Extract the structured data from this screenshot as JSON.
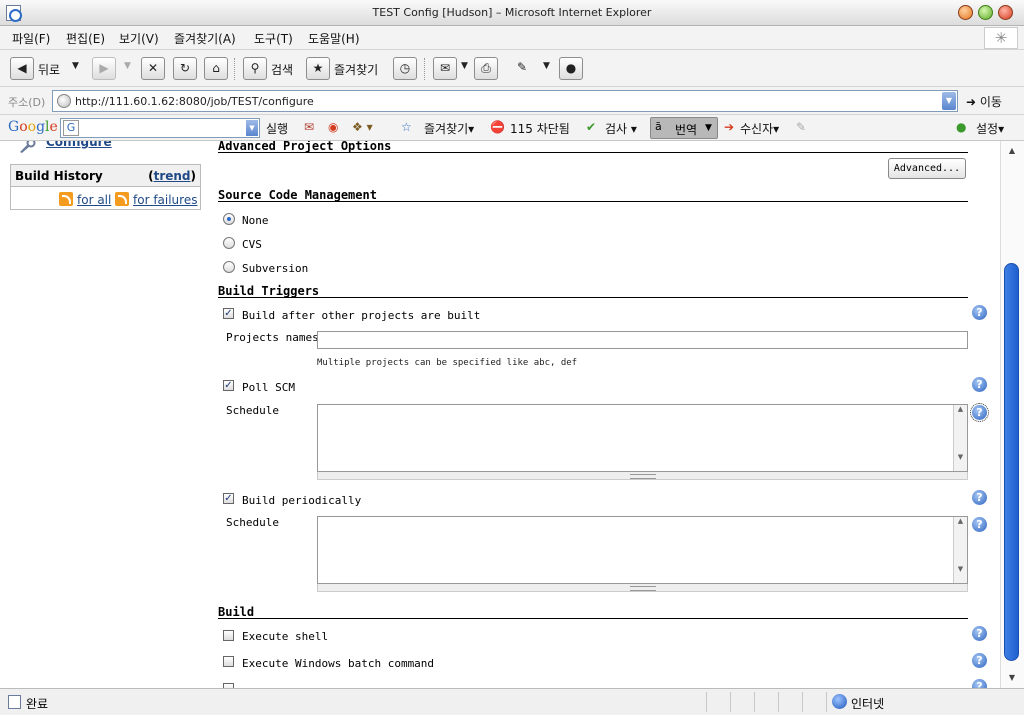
{
  "window": {
    "title": "TEST Config [Hudson] – Microsoft Internet Explorer"
  },
  "menu": [
    "파일(F)",
    "편집(E)",
    "보기(V)",
    "즐겨찾기(A)",
    "도구(T)",
    "도움말(H)"
  ],
  "toolbar": {
    "back": "뒤로",
    "search": "검색",
    "favorites": "즐겨찾기"
  },
  "address": {
    "label": "주소(D)",
    "url": "http://111.60.1.62:8080/job/TEST/configure",
    "go": "이동"
  },
  "google": {
    "logo": "Google",
    "run": "실행",
    "favorites": "즐겨찾기",
    "blocked": "115 차단됨",
    "check": "검사",
    "translate": "번역",
    "recipient": "수신자",
    "settings": "설정"
  },
  "sidebar": {
    "configure": "Configure",
    "build_history": "Build History",
    "trend": "trend",
    "for_all": "for all",
    "for_failures": "for failures"
  },
  "form": {
    "advanced_title": "Advanced Project Options",
    "advanced_button": "Advanced...",
    "scm_title": "Source Code Management",
    "scm_options": [
      "None",
      "CVS",
      "Subversion"
    ],
    "scm_selected": "None",
    "triggers_title": "Build Triggers",
    "trigger_after": "Build after other projects are built",
    "projects_names_label": "Projects names",
    "projects_names_value": "",
    "projects_hint": "Multiple projects can be specified like abc, def",
    "poll_scm": "Poll SCM",
    "schedule_label": "Schedule",
    "build_periodically": "Build periodically",
    "build_title": "Build",
    "execute_shell": "Execute shell",
    "execute_windows": "Execute Windows batch command"
  },
  "status": {
    "text": "완료",
    "zone": "인터넷"
  },
  "colors": {
    "link": "#204a87",
    "scroll_thumb": "#1e5fd0",
    "rss": "#f39c1f"
  }
}
